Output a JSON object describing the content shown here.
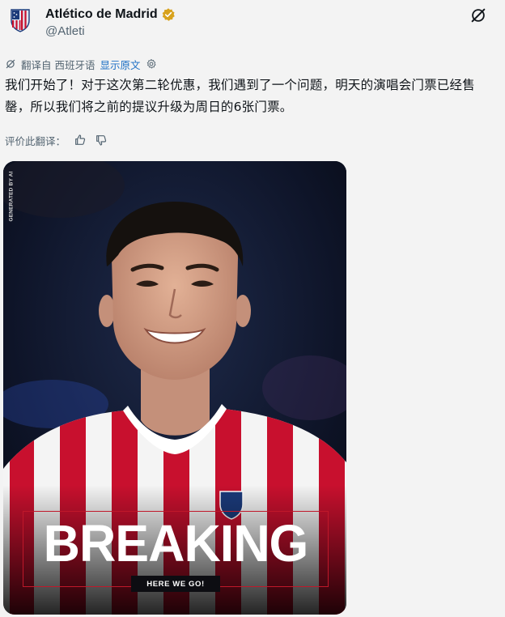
{
  "author": {
    "display_name": "Atlético de Madrid",
    "handle": "@Atleti",
    "verified": true,
    "avatar_icon": "atletico-crest-icon"
  },
  "actions": {
    "grok_icon": "grok-icon"
  },
  "translation": {
    "translated_from": "翻译自 西班牙语",
    "show_original": "显示原文",
    "settings_icon": "gear-icon"
  },
  "post": {
    "text": "我们开始了！对于这次第二轮优惠，我们遇到了一个问题，明天的演唱会门票已经售罄，所以我们将之前的提议升级为周日的6张门票。"
  },
  "rating": {
    "label": "评价此翻译：",
    "thumbs_up_icon": "thumbs-up-icon",
    "thumbs_down_icon": "thumbs-down-icon"
  },
  "media": {
    "generated_tag": "GENERATED BY AI",
    "headline": "BREAKING",
    "tagline": "HERE WE GO!"
  },
  "colors": {
    "link": "#1d6fc4",
    "verified_gold": "#d8a21c",
    "breaking_frame": "#c0182a"
  }
}
